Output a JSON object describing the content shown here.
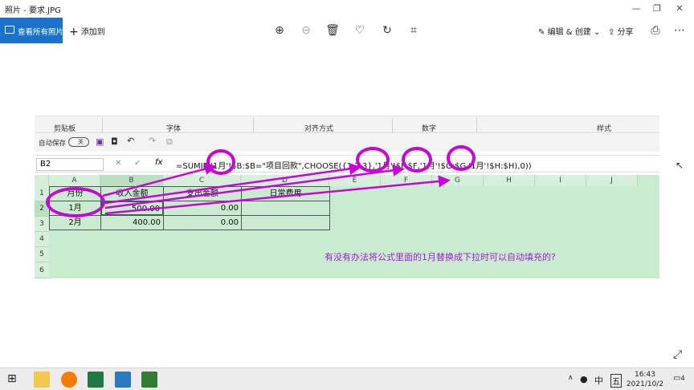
{
  "window": {
    "title": "照片 - 要求.JPG"
  },
  "toolbar": {
    "view_all": "查看所有照片",
    "add_to": "添加到",
    "edit_create": "编辑 & 创建",
    "share": "分享"
  },
  "spreadsheet": {
    "ribbon_groups": [
      "剪贴板",
      "字体",
      "对齐方式",
      "数字",
      "样式"
    ],
    "autosave_label": "自动保存",
    "autosave_state": "关",
    "name_box": "B2",
    "fx_label": "fx",
    "formula": "=SUMIF('1月'!$B:$B=\"项目回款\",CHOOSE({1,2,3},'1月'!$F:$F,'1月'!$G:$G,'1月'!$H:$H),0))",
    "columns": [
      "A",
      "B",
      "C",
      "D",
      "E",
      "F",
      "G",
      "H",
      "I",
      "J"
    ],
    "rows": [
      "1",
      "2",
      "3",
      "4",
      "5",
      "6"
    ],
    "headers": [
      "月份",
      "收入金额",
      "支出金额",
      "日常费用"
    ],
    "data_rows": [
      [
        "1月",
        "500.00",
        "0.00",
        ""
      ],
      [
        "2月",
        "400.00",
        "0.00",
        ""
      ]
    ],
    "question": "有没有办法将公式里面的1月替换成下拉时可以自动填充的?",
    "annotation_color": "#c800d8"
  },
  "taskbar": {
    "ime": "中",
    "ime_mode": "五",
    "time": "16:43",
    "date": "2021/10/2",
    "notifications": "4"
  }
}
